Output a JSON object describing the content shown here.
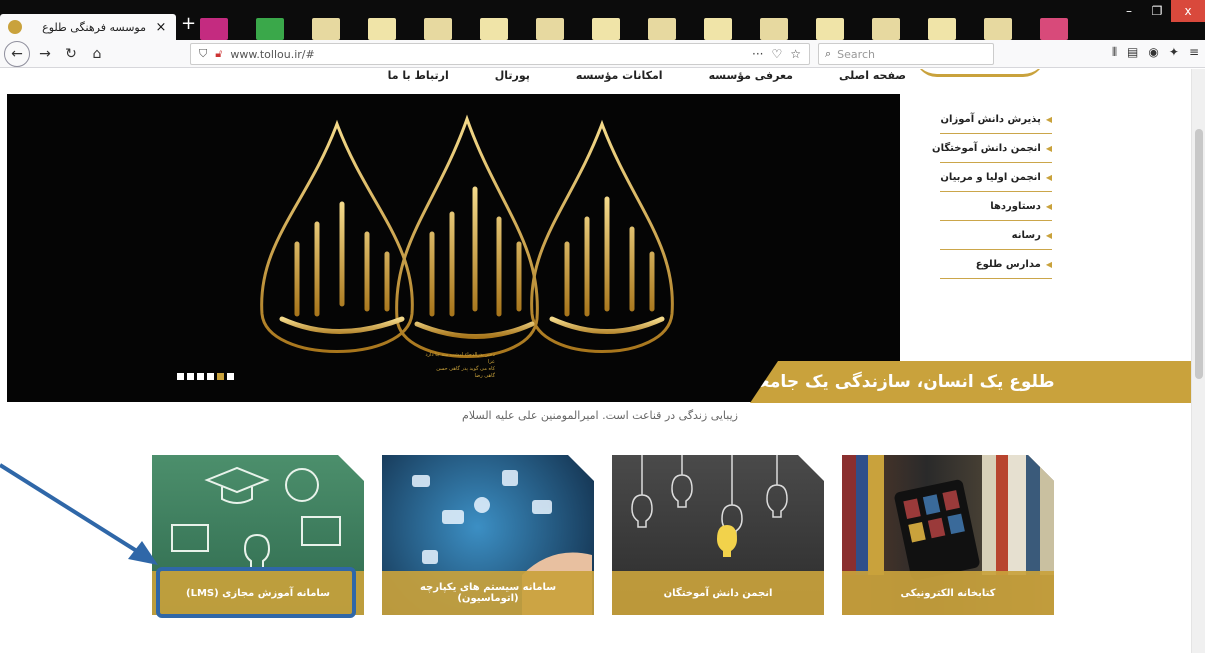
{
  "browser": {
    "tab_title": "موسسه فرهنگی طلوع",
    "tab_close": "×",
    "new_tab": "+",
    "url": "www.tollou.ir/#",
    "search_placeholder": "Search",
    "window": {
      "minimize": "–",
      "restore": "❐",
      "close": "x"
    }
  },
  "site": {
    "top_nav": [
      "صفحه اصلی",
      "معرفی مؤسسه",
      "امکانات مؤسسه",
      "پورتال",
      "ارتباط با ما"
    ],
    "side_menu": [
      "پذیرش دانش آموزان",
      "انجمن دانش آموختگان",
      "انجمن اولیا و مربیان",
      "دستاوردها",
      "رسانه",
      "مدارس طلوع"
    ],
    "slogan": "طلوع یک انسان، سازندگی یک جامعه",
    "quote": "زیبایی زندگی در قناعت است. امیرالمومنین علی علیه السلام",
    "banner_caption_1": "دختر بدرالدجاء امشب سه جا دارد عزا",
    "banner_caption_2": "کاه می گوید پدر گاهی حسن گاهی رضا",
    "slider_count": 6,
    "slider_active": 5,
    "cards": [
      {
        "label": "سامانه آموزش مجازی (LMS)",
        "color": "#3f7c5e"
      },
      {
        "label": "سامانه سیستم های یکپارچه (اتوماسیون)",
        "color": "#1f4a6e"
      },
      {
        "label": "انجمن دانش آموختگان",
        "color": "#3a3a3a"
      },
      {
        "label": "کتابخانه الکترونیکی",
        "color": "#2a2a2a"
      }
    ]
  },
  "colors": {
    "accent": "#c9a23c",
    "highlight": "#2f67a8"
  }
}
